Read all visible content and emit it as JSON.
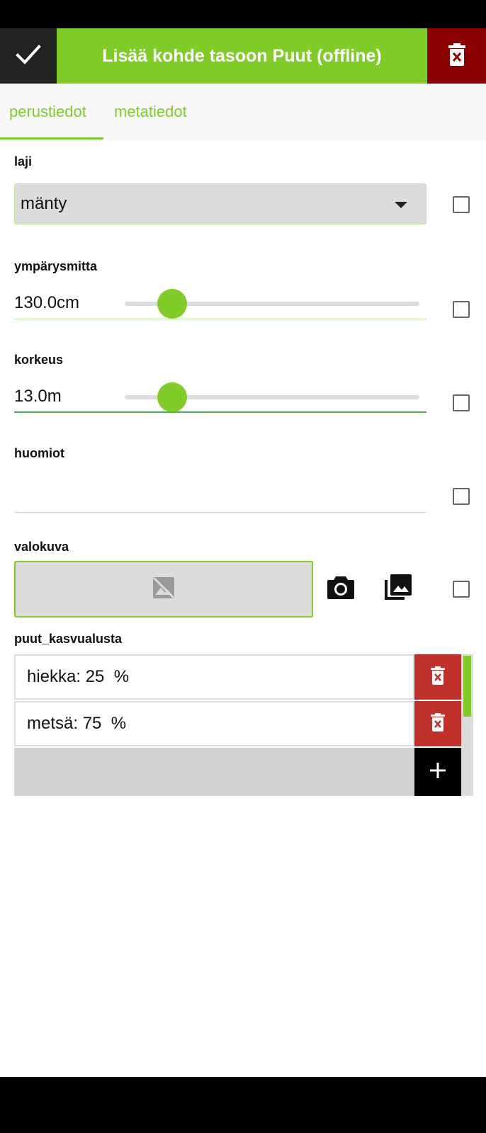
{
  "header": {
    "title": "Lisää kohde tasoon Puut (offline)",
    "accept_icon": "check-icon",
    "delete_icon": "trash-x-icon",
    "accent_color": "#80cc28",
    "delete_color": "#8b0000"
  },
  "tabs": [
    {
      "label": "perustiedot",
      "selected": true
    },
    {
      "label": "metatiedot",
      "selected": false
    }
  ],
  "fields": {
    "laji": {
      "label": "laji",
      "value": "mänty",
      "remember": false
    },
    "ymparysmitta": {
      "label": "ympärysmitta",
      "value": "130.0cm",
      "level_fraction": 0.16,
      "remember": false
    },
    "korkeus": {
      "label": "korkeus",
      "value": "13.0m",
      "level_fraction": 0.16,
      "remember": false
    },
    "huomiot": {
      "label": "huomiot",
      "value": "",
      "remember": false
    },
    "valokuva": {
      "label": "valokuva",
      "placeholder_icon": "image-off-icon",
      "camera_icon": "camera-icon",
      "gallery_icon": "gallery-icon",
      "remember": false
    }
  },
  "relation": {
    "label": "puut_kasvualusta",
    "rows": [
      {
        "text": "hiekka: 25  %"
      },
      {
        "text": "metsä: 75  %"
      }
    ],
    "add_icon": "plus-icon",
    "delete_icon": "trash-x-icon"
  }
}
